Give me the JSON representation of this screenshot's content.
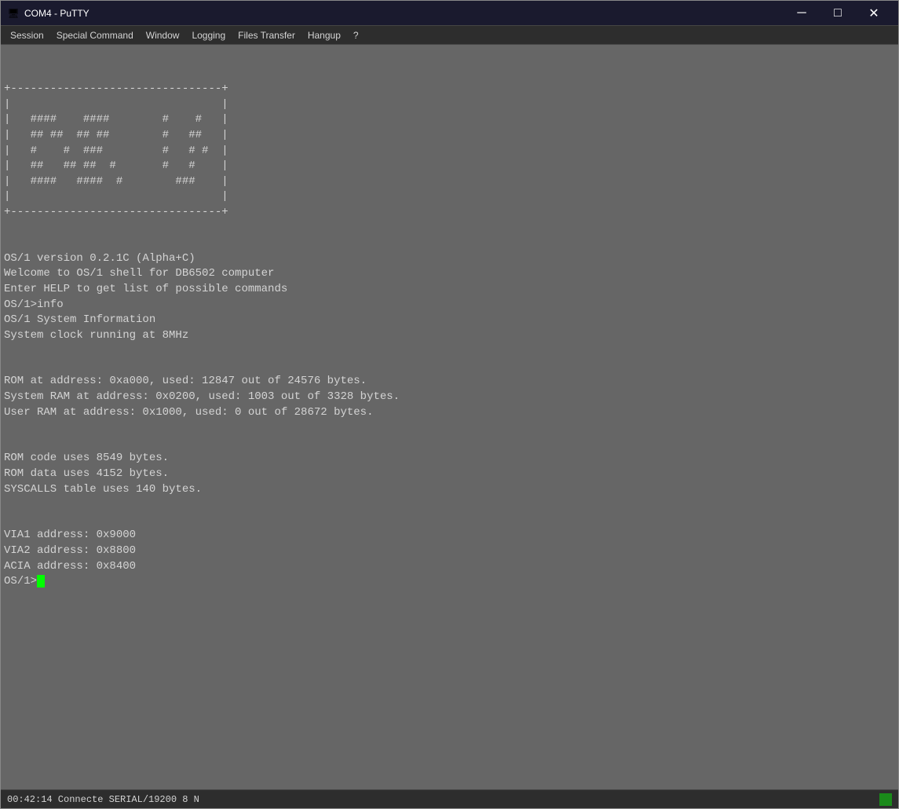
{
  "titleBar": {
    "icon": "🖥",
    "title": "COM4 - PuTTY",
    "minimizeLabel": "─",
    "maximizeLabel": "□",
    "closeLabel": "✕"
  },
  "menuBar": {
    "items": [
      {
        "label": "Session"
      },
      {
        "label": "Special Command"
      },
      {
        "label": "Window"
      },
      {
        "label": "Logging"
      },
      {
        "label": "Files Transfer"
      },
      {
        "label": "Hangup"
      },
      {
        "label": "?"
      }
    ]
  },
  "terminal": {
    "lines": [
      "",
      "+--------------------------------+",
      "|                                |",
      "|   ####    ####        #    #   |",
      "|   ## ##  ## ##        #   ##   |",
      "|   #    #  ###         #   # #  |",
      "|   ##   ## ##  #       #   #    |",
      "|   ####   ####  #        ###    |",
      "|                                |",
      "+--------------------------------+",
      "",
      "OS/1 version 0.2.1C (Alpha+C)",
      "Welcome to OS/1 shell for DB6502 computer",
      "Enter HELP to get list of possible commands",
      "OS/1>info",
      "OS/1 System Information",
      "System clock running at 8MHz",
      "",
      "ROM at address: 0xa000, used: 12847 out of 24576 bytes.",
      "System RAM at address: 0x0200, used: 1003 out of 3328 bytes.",
      "User RAM at address: 0x1000, used: 0 out of 28672 bytes.",
      "",
      "ROM code uses 8549 bytes.",
      "ROM data uses 4152 bytes.",
      "SYSCALLS table uses 140 bytes.",
      "",
      "VIA1 address: 0x9000",
      "VIA2 address: 0x8800",
      "ACIA address: 0x8400",
      "OS/1>"
    ],
    "cursorVisible": true
  },
  "statusBar": {
    "text": "00:42:14 Connecte SERIAL/19200 8 N"
  }
}
